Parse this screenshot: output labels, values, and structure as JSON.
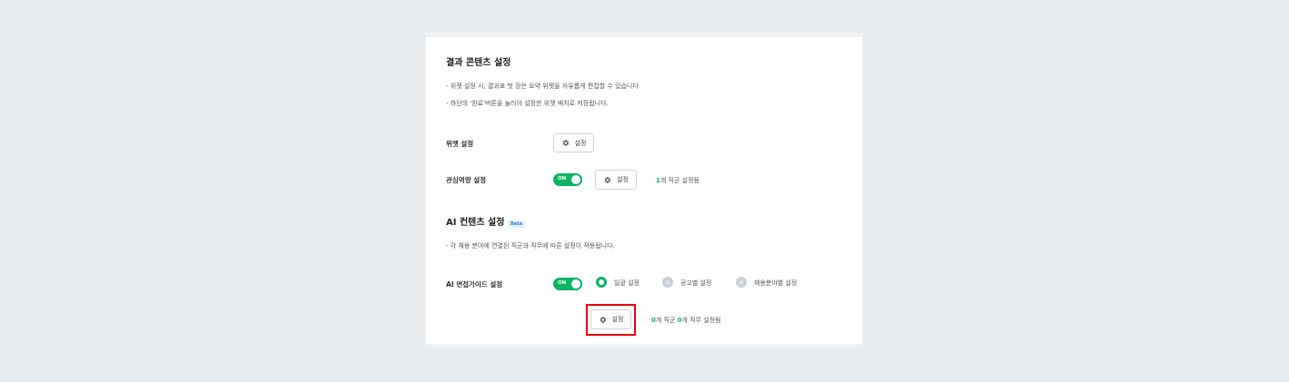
{
  "result_content": {
    "title": "결과 콘텐츠 설정",
    "desc1": "- 위젯 설정 시, 결과표 첫 장은 요약 위젯을 자유롭게 편집할 수 있습니다.",
    "desc2": "- 하단의 '완료'버튼을 눌러야 설정한 위젯 배치로 저장됩니다."
  },
  "widget_setting": {
    "label": "위젯 설정",
    "button_label": "설정",
    "icon": "gear-icon"
  },
  "interest_setting": {
    "label": "관심역량 설정",
    "toggle_label": "ON",
    "button_label": "설정",
    "count_value": "1",
    "count_suffix": "개 직군 설정됨"
  },
  "ai_content": {
    "title": "AI 컨텐츠 설정",
    "badge": "Beta",
    "desc": "- 각 채용 분야에 연결된 직군과 직무에 따른 설정이 적용됩니다."
  },
  "ai_interview": {
    "label": "AI 면접가이드 설정",
    "toggle_label": "ON",
    "radio_options": [
      {
        "label": "일괄 설정",
        "selected": true
      },
      {
        "label": "공고별 설정",
        "selected": false
      },
      {
        "label": "채용분야별 설정",
        "selected": false
      }
    ],
    "button_label": "설정",
    "count_a": "0",
    "count_a_suffix": "개 직군 ",
    "count_b": "0",
    "count_b_suffix": "개 직무 설정됨"
  },
  "colors": {
    "accent": "#0ab464",
    "highlight": "#e60012",
    "background": "#e9ecef"
  }
}
